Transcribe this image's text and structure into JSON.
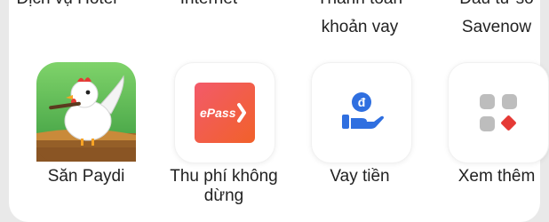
{
  "top_services": [
    {
      "label_cut": "Dịch vụ Hotel"
    },
    {
      "label_cut": "Internet"
    },
    {
      "label_cut": "Thanh toán",
      "label_line2": "khoản vay"
    },
    {
      "label_cut": "Đầu tư số",
      "label_line2": "Savenow"
    }
  ],
  "services": [
    {
      "label": "Săn Paydi",
      "icon": "chicken-game-icon"
    },
    {
      "label_line1": "Thu phí không",
      "label_line2": "dừng",
      "icon": "epass-icon",
      "badge_text": "ePass"
    },
    {
      "label": "Vay tiền",
      "icon": "loan-hand-coin-icon",
      "coin_symbol": "đ"
    },
    {
      "label": "Xem thêm",
      "icon": "more-grid-icon"
    }
  ],
  "colors": {
    "epass_gradient_start": "#f35a6a",
    "epass_gradient_end": "#f1612a",
    "loan_blue": "#2f6fe0",
    "more_grey": "#bdbdbd",
    "more_red": "#e53935"
  }
}
